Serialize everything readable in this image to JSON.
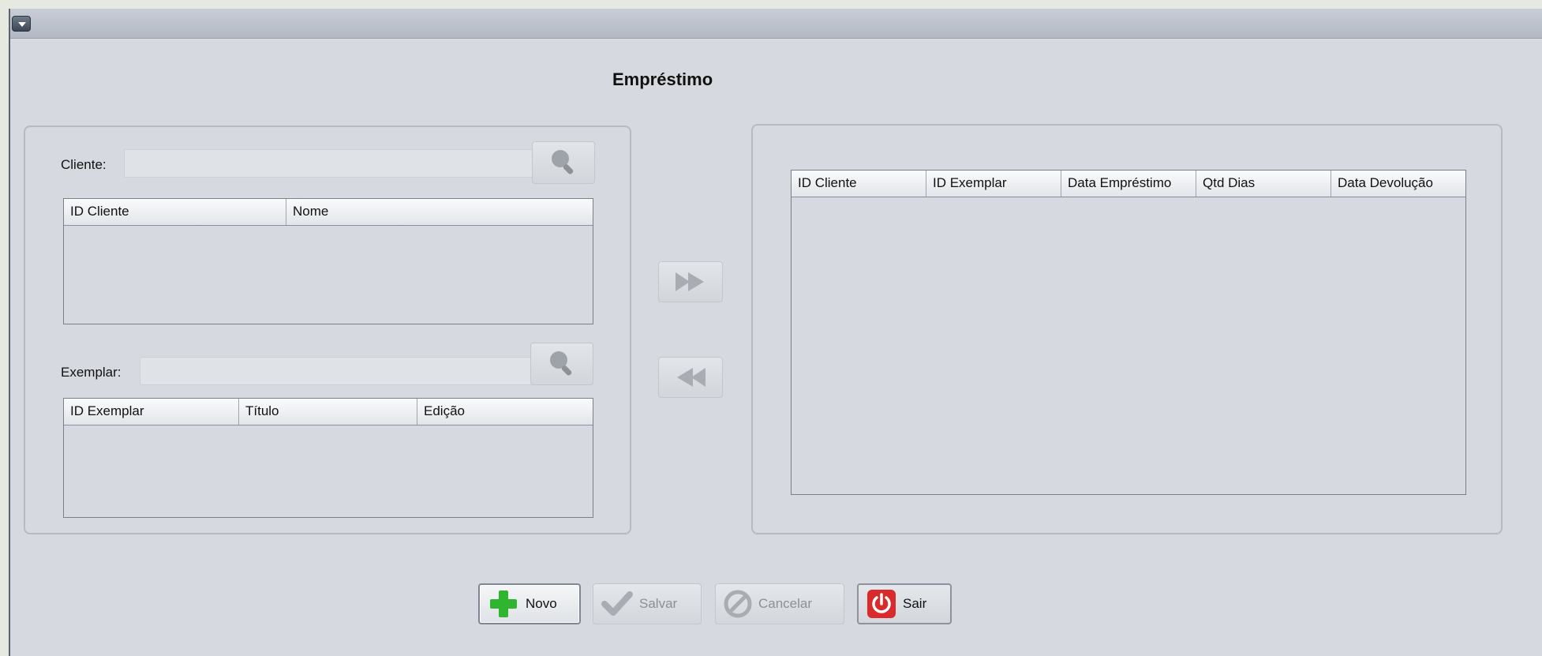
{
  "window": {
    "title": "Empréstimo"
  },
  "cliente": {
    "label": "Cliente:",
    "value": "",
    "table_headers": [
      "ID Cliente",
      "Nome"
    ]
  },
  "exemplar": {
    "label": "Exemplar:",
    "value": "",
    "table_headers": [
      "ID Exemplar",
      "Título",
      "Edição"
    ]
  },
  "emprestimos": {
    "table_headers": [
      "ID Cliente",
      "ID Exemplar",
      "Data Empréstimo",
      "Qtd Dias",
      "Data Devolução"
    ]
  },
  "buttons": {
    "novo": "Novo",
    "salvar": "Salvar",
    "cancelar": "Cancelar",
    "sair": "Sair"
  },
  "icons": {
    "search": "magnifier-icon",
    "add": "fast-forward-icon",
    "remove": "fast-rewind-icon",
    "novo": "plus-icon",
    "salvar": "check-icon",
    "cancelar": "cancel-icon",
    "sair": "power-icon"
  },
  "colors": {
    "novo_icon": "#2fb52f",
    "sair_icon": "#d92b2b",
    "disabled_icon": "#a9adb3"
  }
}
